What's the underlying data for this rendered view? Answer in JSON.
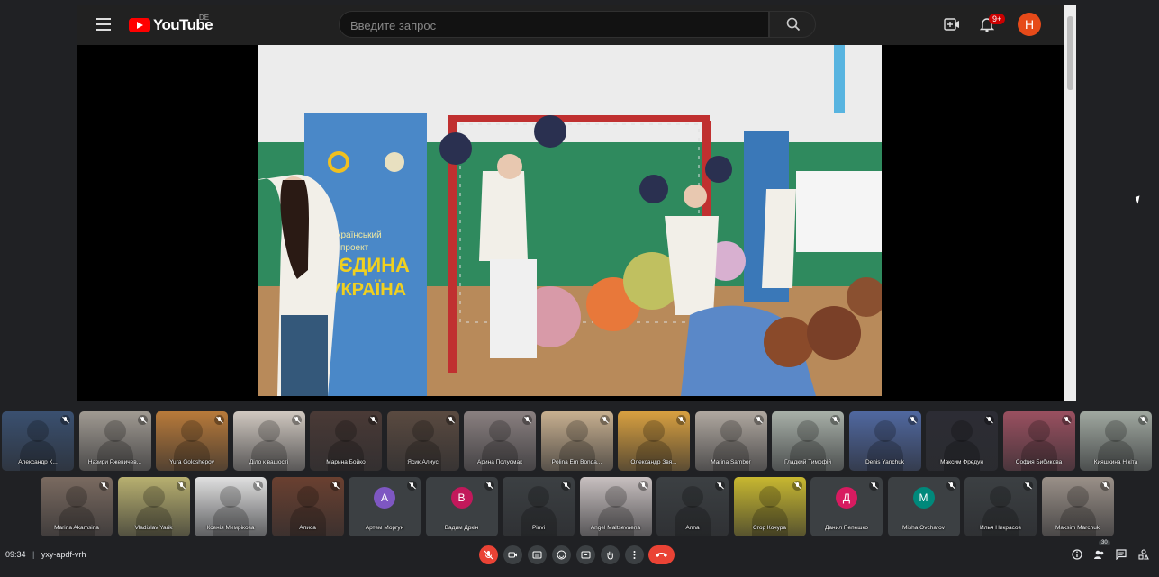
{
  "youtube": {
    "logo_text": "YouTube",
    "region": "DE",
    "search_placeholder": "Введите запрос",
    "notifications_badge": "9+",
    "avatar_letter": "H",
    "banner_line1": "Всеукраїнський",
    "banner_line2": "проект",
    "banner_line3": "ЄДИНА",
    "banner_line4": "УКРАЇНА"
  },
  "participants_row1": [
    {
      "name": "Александр К...",
      "tone": "#3a5070"
    },
    {
      "name": "Назири Ржевичев...",
      "tone": "#a09a92"
    },
    {
      "name": "Yura Goloshepov",
      "tone": "#b87a3a"
    },
    {
      "name": "Діло к вашості",
      "tone": "#d0c8c0"
    },
    {
      "name": "Марина Бойко",
      "tone": "#4a3a36"
    },
    {
      "name": "Ясик Алиус",
      "tone": "#5a4a40"
    },
    {
      "name": "Арина Полусмак",
      "tone": "#8a8080"
    },
    {
      "name": "Polina Em Bondа...",
      "tone": "#c8b090"
    },
    {
      "name": "Олександр Звя...",
      "tone": "#d8a040"
    },
    {
      "name": "Marina Sambor",
      "tone": "#b0a8a0"
    },
    {
      "name": "Гладкий Тимофій",
      "tone": "#a8b0a8"
    },
    {
      "name": "Denis Yanchuk",
      "tone": "#5068a0"
    },
    {
      "name": "Максим Фредун",
      "tone": "#2c2c34"
    },
    {
      "name": "София Бибикова",
      "tone": "#9a5060"
    },
    {
      "name": "Кияшкина Нікіта",
      "tone": "#a0a8a0"
    }
  ],
  "participants_row2": [
    {
      "name": "Marina Akamsina",
      "tone": "#7a6a60"
    },
    {
      "name": "Vladislav Yarik",
      "tone": "#b8b070"
    },
    {
      "name": "Ксенія Мимрікова",
      "tone": "#e0e0e0"
    },
    {
      "name": "Алиса",
      "tone": "#6a4030"
    },
    {
      "name": "Артем Моргун",
      "initial": "А",
      "avatar_color": "#7e57c2"
    },
    {
      "name": "Вадим Дркін",
      "initial": "В",
      "avatar_color": "#c2185b"
    },
    {
      "name": "Pinvi",
      "tone": "#3c4043"
    },
    {
      "name": "Angel Maltsevaena",
      "tone": "#c8c0c0"
    },
    {
      "name": "Anna",
      "tone": "#3c4043"
    },
    {
      "name": "Єгор Кочура",
      "tone": "#c8b830"
    },
    {
      "name": "Данил Пепешко",
      "initial": "Д",
      "avatar_color": "#d81b60"
    },
    {
      "name": "Misha Ovcharov",
      "initial": "M",
      "avatar_color": "#00897b"
    },
    {
      "name": "Илья Никрасов",
      "tone": "#3c4043"
    },
    {
      "name": "Maksim Marchuk",
      "tone": "#9a9088"
    }
  ],
  "meeting": {
    "time": "09:34",
    "separator": "|",
    "code": "yxy-apdf-vrh",
    "participant_count": "30"
  },
  "colors": {
    "danger": "#ea4335",
    "control_bg": "#3c4043",
    "page_bg": "#202124"
  }
}
